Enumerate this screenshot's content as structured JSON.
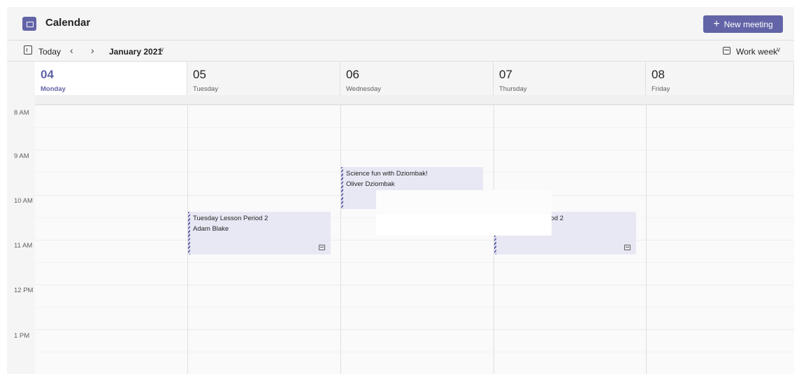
{
  "app": {
    "title": "Calendar",
    "icon": "calendar-app-icon"
  },
  "header": {
    "new_meeting_label": "New meeting",
    "new_meeting_icon": "plus-icon"
  },
  "toolbar": {
    "today_label": "Today",
    "prev_icon": "chevron-left-icon",
    "next_icon": "chevron-right-icon",
    "month_label": "January 2021",
    "view_label": "Work week"
  },
  "days": [
    {
      "num": "04",
      "name": "Monday"
    },
    {
      "num": "05",
      "name": "Tuesday"
    },
    {
      "num": "06",
      "name": "Wednesday"
    },
    {
      "num": "07",
      "name": "Thursday"
    },
    {
      "num": "08",
      "name": "Friday"
    }
  ],
  "times": [
    "8 AM",
    "9 AM",
    "10 AM",
    "11 AM",
    "12 PM",
    "1 PM"
  ],
  "events": [
    {
      "title": "Science fun with Dziombak!",
      "organizer": "Oliver Dziombak",
      "day": "Wednesday"
    },
    {
      "title": "Tuesday Lesson Period 2",
      "organizer": "Adam Blake",
      "day": "Tuesday"
    },
    {
      "title": "eriod 2",
      "organizer": "",
      "day": "Thursday"
    }
  ],
  "colors": {
    "accent": "#6264a7",
    "event_bg": "#e8e8f5",
    "background": "#f5f5f5"
  }
}
